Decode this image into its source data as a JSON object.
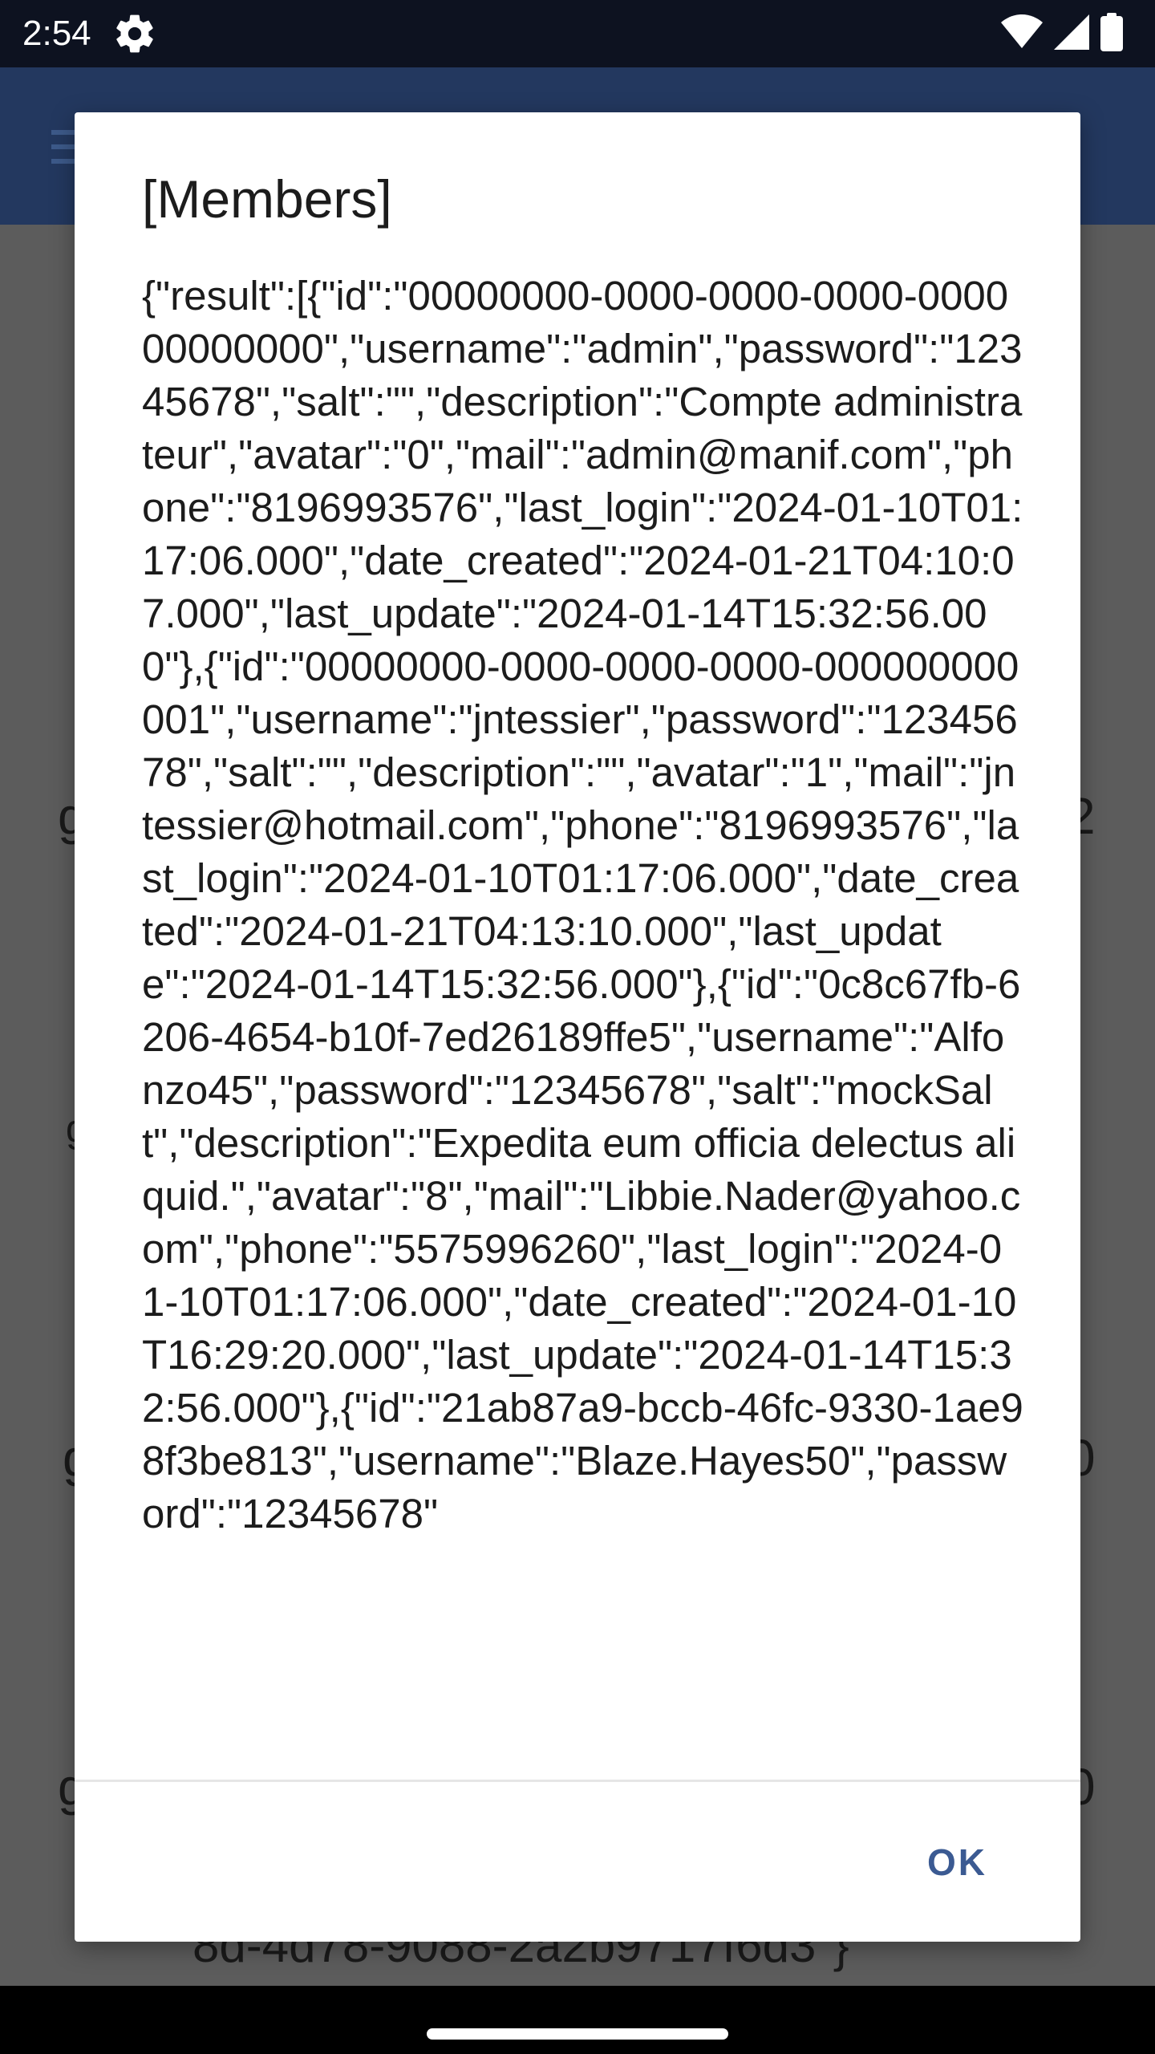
{
  "status_bar": {
    "time": "2:54",
    "icons": [
      "settings-gear-icon",
      "wifi-icon",
      "cell-signal-icon",
      "battery-icon"
    ]
  },
  "app_background": {
    "bar_color": "#23385f",
    "peek_text_left": [
      "g",
      "g",
      "g",
      "g"
    ],
    "peek_text_right": [
      "2",
      "0",
      "0"
    ],
    "peek_bottom_text": "8d-4d78-9088-2a2b9717f6d3\"}"
  },
  "dialog": {
    "title": "[Members]",
    "message": "{\"result\":[{\"id\":\"00000000-0000-0000-0000-000000000000\",\"username\":\"admin\",\"password\":\"12345678\",\"salt\":\"\",\"description\":\"Compte administrateur\",\"avatar\":\"0\",\"mail\":\"admin@manif.com\",\"phone\":\"8196993576\",\"last_login\":\"2024-01-10T01:17:06.000\",\"date_created\":\"2024-01-21T04:10:07.000\",\"last_update\":\"2024-01-14T15:32:56.000\"},{\"id\":\"00000000-0000-0000-0000-000000000001\",\"username\":\"jntessier\",\"password\":\"12345678\",\"salt\":\"\",\"description\":\"\",\"avatar\":\"1\",\"mail\":\"jntessier@hotmail.com\",\"phone\":\"8196993576\",\"last_login\":\"2024-01-10T01:17:06.000\",\"date_created\":\"2024-01-21T04:13:10.000\",\"last_update\":\"2024-01-14T15:32:56.000\"},{\"id\":\"0c8c67fb-6206-4654-b10f-7ed26189ffe5\",\"username\":\"Alfonzo45\",\"password\":\"12345678\",\"salt\":\"mockSalt\",\"description\":\"Expedita eum officia delectus aliquid.\",\"avatar\":\"8\",\"mail\":\"Libbie.Nader@yahoo.com\",\"phone\":\"5575996260\",\"last_login\":\"2024-01-10T01:17:06.000\",\"date_created\":\"2024-01-10T16:29:20.000\",\"last_update\":\"2024-01-14T15:32:56.000\"},{\"id\":\"21ab87a9-bccb-46fc-9330-1ae98f3be813\",\"username\":\"Blaze.Hayes50\",\"password\":\"12345678\"",
    "ok_label": "OK"
  },
  "colors": {
    "accent": "#3b5a92",
    "status_bar": "#0d1220",
    "app_bar": "#23385f",
    "scrim_content": "#5c5c5c"
  }
}
